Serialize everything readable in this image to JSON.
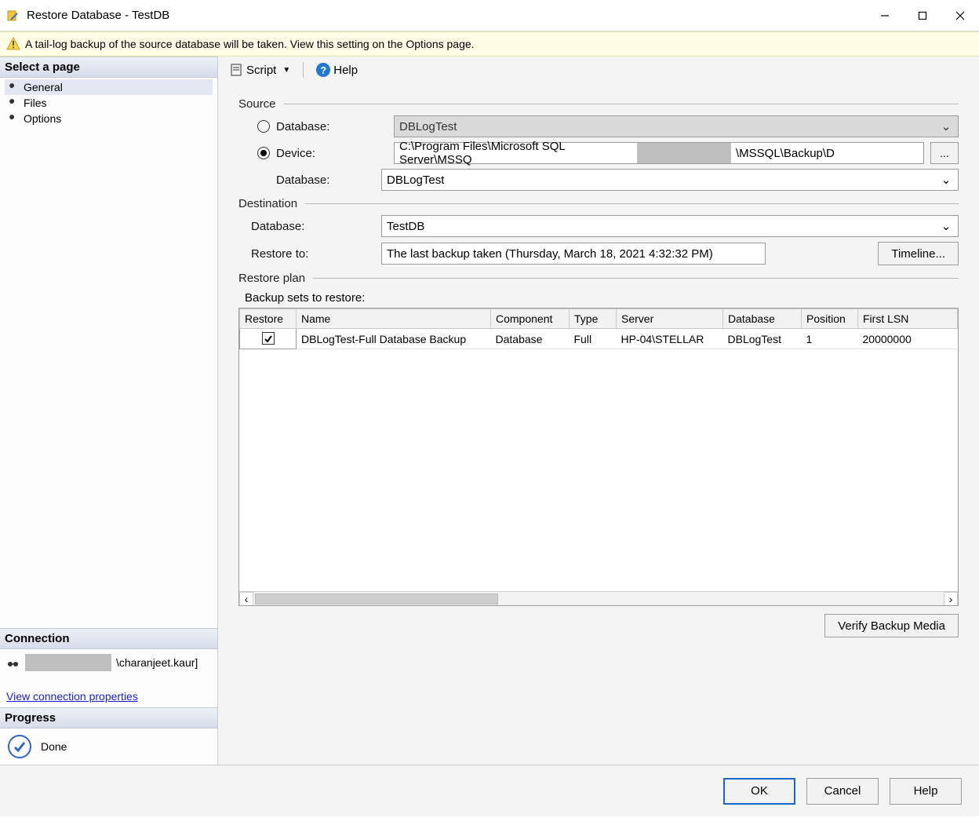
{
  "window": {
    "title": "Restore Database - TestDB"
  },
  "warning": {
    "text": "A tail-log backup of the source database will be taken. View this setting on the Options page."
  },
  "sidebar": {
    "select_page": "Select a page",
    "items": [
      {
        "label": "General"
      },
      {
        "label": "Files"
      },
      {
        "label": "Options"
      }
    ],
    "connection_head": "Connection",
    "connection_user": "\\charanjeet.kaur]",
    "view_connection": "View connection properties",
    "progress_head": "Progress",
    "progress_status": "Done"
  },
  "toolbar": {
    "script": "Script",
    "help": "Help"
  },
  "source": {
    "head": "Source",
    "database_label": "Database:",
    "database_value": "DBLogTest",
    "device_label": "Device:",
    "device_path_a": "C:\\Program Files\\Microsoft SQL Server\\MSSQ",
    "device_path_b": "\\MSSQL\\Backup\\D",
    "browse": "...",
    "sub_database_label": "Database:",
    "sub_database_value": "DBLogTest"
  },
  "destination": {
    "head": "Destination",
    "database_label": "Database:",
    "database_value": "TestDB",
    "restore_to_label": "Restore to:",
    "restore_to_value": "The last backup taken (Thursday, March 18, 2021 4:32:32 PM)",
    "timeline": "Timeline..."
  },
  "plan": {
    "head": "Restore plan",
    "subhead": "Backup sets to restore:",
    "columns": [
      "Restore",
      "Name",
      "Component",
      "Type",
      "Server",
      "Database",
      "Position",
      "First LSN"
    ],
    "rows": [
      {
        "checked": true,
        "name": "DBLogTest-Full Database Backup",
        "component": "Database",
        "type": "Full",
        "server": "HP-04\\STELLAR",
        "database": "DBLogTest",
        "position": "1",
        "first_lsn": "20000000"
      }
    ],
    "verify": "Verify Backup Media"
  },
  "footer": {
    "ok": "OK",
    "cancel": "Cancel",
    "help": "Help"
  }
}
